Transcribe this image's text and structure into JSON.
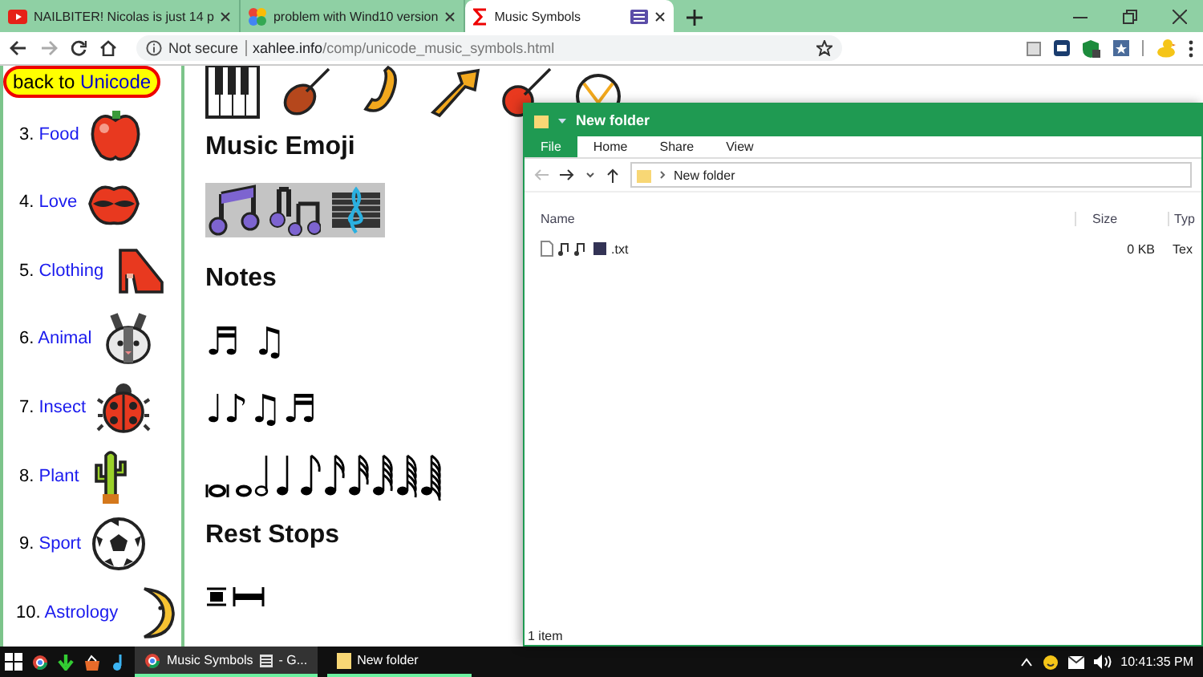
{
  "browser": {
    "tabs": [
      {
        "label": "NAILBITER! Nicolas is just 14 p",
        "selected": false
      },
      {
        "label": "problem with Wind10 version",
        "selected": false
      },
      {
        "label": "Music Symbols",
        "selected": true
      }
    ],
    "security": "Not secure",
    "url_host": "xahlee.info",
    "url_path": "/comp/unicode_music_symbols.html"
  },
  "sidebar": {
    "back_button": {
      "prefix": "back to ",
      "link": "Unicode"
    },
    "items": [
      {
        "number": "3.",
        "label": "Food",
        "kind": "apple"
      },
      {
        "number": "4.",
        "label": "Love",
        "kind": "lips"
      },
      {
        "number": "5.",
        "label": "Clothing",
        "kind": "shoe"
      },
      {
        "number": "6.",
        "label": "Animal",
        "kind": "rabbit"
      },
      {
        "number": "7.",
        "label": "Insect",
        "kind": "ladybug"
      },
      {
        "number": "8.",
        "label": "Plant",
        "kind": "cactus"
      },
      {
        "number": "9.",
        "label": "Sport",
        "kind": "ball"
      },
      {
        "number": "10.",
        "label": "Astrology",
        "kind": "moon"
      }
    ]
  },
  "content": {
    "sections": [
      {
        "kind": "instruments"
      },
      {
        "kind": "heading",
        "text": "Music Emoji"
      },
      {
        "kind": "emoji"
      },
      {
        "kind": "heading",
        "text": "Notes"
      },
      {
        "kind": "notes",
        "text": "♬ ♫"
      },
      {
        "kind": "notes",
        "text": "♩♪♫♬"
      },
      {
        "kind": "note_values"
      },
      {
        "kind": "heading",
        "text": "Rest Stops"
      },
      {
        "kind": "rests"
      }
    ]
  },
  "explorer": {
    "title": "New folder",
    "ribbon_tabs": [
      {
        "label": "File",
        "selected": true
      },
      {
        "label": "Home",
        "selected": false
      },
      {
        "label": "Share",
        "selected": false
      },
      {
        "label": "View",
        "selected": false
      }
    ],
    "breadcrumb": "New folder",
    "columns": [
      "Name",
      "Size",
      "Typ"
    ],
    "files": [
      {
        "name": ".txt",
        "size": "0 KB",
        "type": "Tex"
      }
    ],
    "status": "1 item"
  },
  "taskbar": {
    "tasks": [
      {
        "label": "Music Symbols",
        "suffix": "- G...",
        "selected": true
      },
      {
        "label": "New folder",
        "selected": false
      }
    ],
    "time": "10:41:35 PM"
  }
}
